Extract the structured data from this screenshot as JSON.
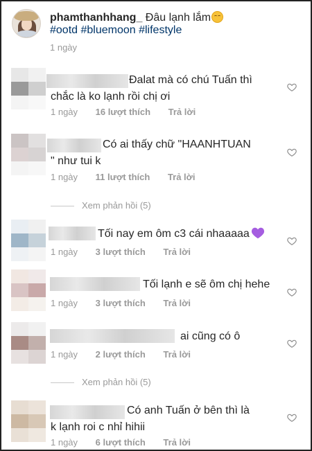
{
  "caption": {
    "username": "phamthanhhang_",
    "text": "Đâu lạnh lắm",
    "tags": "#ootd #bluemoon #lifestyle",
    "time": "1 ngày"
  },
  "comments": [
    {
      "line1": "Đalat mà có chú Tuấn thì",
      "line2": "chắc là ko lạnh rồi chị ơi",
      "time": "1 ngày",
      "likes": "16 lượt thích",
      "reply": "Trả lời"
    },
    {
      "line1": "Có ai thấy chữ \"HAANHTUAN",
      "line2": "\" như tui k",
      "time": "1 ngày",
      "likes": "11 lượt thích",
      "reply": "Trả lời",
      "view_replies": "Xem phản hồi (5)"
    },
    {
      "line1": "Tối nay em ôm c3 cái nhaaaaa",
      "time": "1 ngày",
      "likes": "3 lượt thích",
      "reply": "Trả lời"
    },
    {
      "line1": "Tối lạnh e sẽ ôm chị hehe",
      "time": "1 ngày",
      "likes": "3 lượt thích",
      "reply": "Trả lời"
    },
    {
      "line1": "ai cũng có ô",
      "time": "1 ngày",
      "likes": "2 lượt thích",
      "reply": "Trả lời",
      "view_replies": "Xem phản hồi (5)"
    },
    {
      "line1": "Có anh Tuấn ở bên thì là",
      "line2": "k lạnh  roi  c nhỉ hihii",
      "time": "1 ngày",
      "likes": "6 lượt thích",
      "reply": "Trả lời"
    }
  ],
  "icons": {
    "like": "heart-outline-icon",
    "emoji_smile": "smiling-face-emoji",
    "emoji_heart": "purple-heart-emoji"
  },
  "colors": {
    "hashtag": "#003569",
    "meta_gray": "#999999",
    "purple_heart": "#a55de0"
  }
}
